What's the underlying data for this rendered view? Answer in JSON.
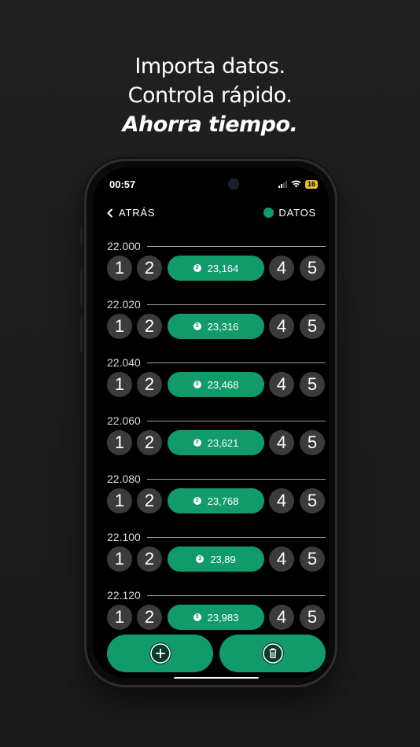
{
  "headline": {
    "line1": "Importa datos.",
    "line2": "Controla rápido.",
    "line3": "Ahorra tiempo."
  },
  "status_bar": {
    "time": "00:57",
    "battery": "16"
  },
  "nav": {
    "back_label": "ATRÁS",
    "data_label": "DATOS"
  },
  "groups": [
    {
      "label": "22.000",
      "buttons": [
        "1",
        "2",
        "4",
        "5"
      ],
      "value": "23,164"
    },
    {
      "label": "22.020",
      "buttons": [
        "1",
        "2",
        "4",
        "5"
      ],
      "value": "23,316"
    },
    {
      "label": "22.040",
      "buttons": [
        "1",
        "2",
        "4",
        "5"
      ],
      "value": "23,468"
    },
    {
      "label": "22.060",
      "buttons": [
        "1",
        "2",
        "4",
        "5"
      ],
      "value": "23,621"
    },
    {
      "label": "22.080",
      "buttons": [
        "1",
        "2",
        "4",
        "5"
      ],
      "value": "23,768"
    },
    {
      "label": "22.100",
      "buttons": [
        "1",
        "2",
        "4",
        "5"
      ],
      "value": "23,89"
    },
    {
      "label": "22.120",
      "buttons": [
        "1",
        "2",
        "4",
        "5"
      ],
      "value": "23,983"
    }
  ],
  "pill_badge": "3",
  "colors": {
    "accent": "#119b6a",
    "circle": "#3b3b3b",
    "background": "#1d1d1d"
  },
  "actions": {
    "add_icon": "plus-circle-icon",
    "delete_icon": "trash-icon"
  }
}
